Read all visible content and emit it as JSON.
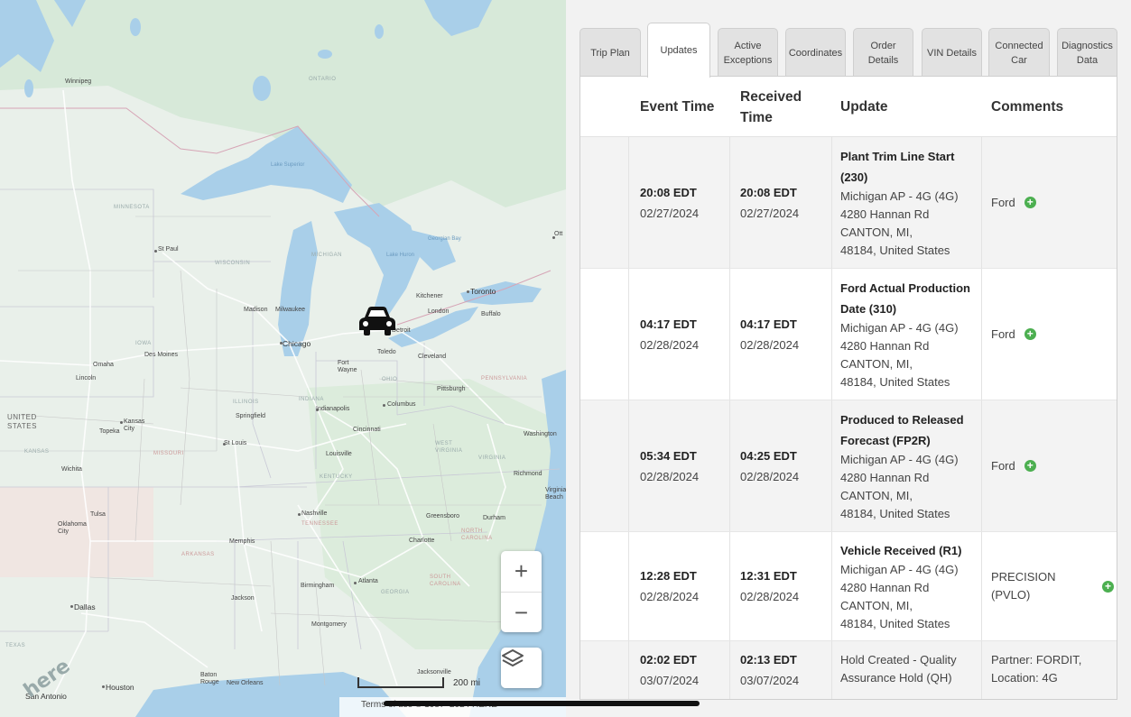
{
  "map": {
    "labels": {
      "winnipeg": "Winnipeg",
      "ontario": "ONTARIO",
      "minnesota": "MINNESOTA",
      "lake_superior": "Lake Superior",
      "st_paul": "St Paul",
      "wisconsin": "WISCONSIN",
      "michigan": "MICHIGAN",
      "lake_huron": "Lake Huron",
      "georgian_bay": "Georgian Bay",
      "ottawa": "Ott",
      "toronto": "Toronto",
      "kitchener": "Kitchener",
      "london": "London",
      "buffalo": "Buffalo",
      "madison": "Madison",
      "milwaukee": "Milwaukee",
      "chicago": "Chicago",
      "detroit": "Detroit",
      "toledo": "Toledo",
      "cleveland": "Cleveland",
      "fort_wayne": "Fort Wayne",
      "iowa": "IOWA",
      "des_moines": "Des Moines",
      "omaha": "Omaha",
      "lincoln": "Lincoln",
      "illinois": "ILLINOIS",
      "indiana": "INDIANA",
      "ohio": "OHIO",
      "pennsylvania": "PENNSYLVANIA",
      "pittsburgh": "Pittsburgh",
      "columbus": "Columbus",
      "indianapolis": "Indianapolis",
      "springfield": "Springfield",
      "cincinnati": "Cincinnati",
      "united_states": "UNITED STATES",
      "kansas_city": "Kansas City",
      "topeka": "Topeka",
      "kansas": "KANSAS",
      "missouri": "MISSOURI",
      "st_louis": "St Louis",
      "louisville": "Louisville",
      "washington": "Washington",
      "west_virginia": "WEST VIRGINIA",
      "virginia": "VIRGINIA",
      "richmond": "Richmond",
      "kentucky": "KENTUCKY",
      "wichita": "Wichita",
      "virginia_beach": "Virginia Beach",
      "tulsa": "Tulsa",
      "oklahoma_city": "Oklahoma City",
      "nashville": "Nashville",
      "tennessee": "TENNESSEE",
      "greensboro": "Greensboro",
      "durham": "Durham",
      "north_carolina": "NORTH CAROLINA",
      "charlotte": "Charlotte",
      "memphis": "Memphis",
      "arkansas": "ARKANSAS",
      "south_carolina": "SOUTH CAROLINA",
      "atlanta": "Atlanta",
      "georgia": "GEORGIA",
      "birmingham": "Birmingham",
      "dallas": "Dallas",
      "jackson": "Jackson",
      "montgomery": "Montgomery",
      "texas": "TEXAS",
      "baton_rouge": "Baton Rouge",
      "new_orleans": "New Orleans",
      "houston": "Houston",
      "jacksonville": "Jacksonville",
      "san_antonio": "San Antonio"
    },
    "vehicle_icon": "car-icon",
    "zoom_in": "+",
    "zoom_out": "−",
    "scale_label": "200 mi",
    "logo": "here",
    "terms_text": "Terms of use   © 1987–2024 HERE"
  },
  "tabs": [
    {
      "label": "Trip Plan"
    },
    {
      "label": "Updates"
    },
    {
      "label": "Active Exceptions"
    },
    {
      "label": "Coordinates"
    },
    {
      "label": "Order Details"
    },
    {
      "label": "VIN Details"
    },
    {
      "label": "Connected Car"
    },
    {
      "label": "Diagnostics Data"
    }
  ],
  "active_tab": "Updates",
  "table": {
    "headers": {
      "event_time": "Event Time",
      "received_time": "Received Time",
      "update": "Update",
      "comments": "Comments"
    },
    "rows": [
      {
        "event_time": "20:08 EDT",
        "event_date": "02/27/2024",
        "received_time": "20:08 EDT",
        "received_date": "02/27/2024",
        "update_title": "Plant Trim Line Start  (230)",
        "update_lines": [
          "Michigan AP - 4G (4G)",
          "4280 Hannan Rd",
          "CANTON, MI,",
          "48184, United States"
        ],
        "comment": "Ford",
        "has_add": true
      },
      {
        "event_time": "04:17 EDT",
        "event_date": "02/28/2024",
        "received_time": "04:17 EDT",
        "received_date": "02/28/2024",
        "update_title": "Ford Actual Production Date  (310)",
        "update_lines": [
          "Michigan AP - 4G (4G)",
          "4280 Hannan Rd",
          "CANTON, MI,",
          "48184, United States"
        ],
        "comment": "Ford",
        "has_add": true
      },
      {
        "event_time": "05:34 EDT",
        "event_date": "02/28/2024",
        "received_time": "04:25 EDT",
        "received_date": "02/28/2024",
        "update_title": "Produced to Released Forecast  (FP2R)",
        "update_lines": [
          "Michigan AP - 4G (4G)",
          "4280 Hannan Rd",
          "CANTON, MI,",
          "48184, United States"
        ],
        "comment": "Ford",
        "has_add": true
      },
      {
        "event_time": "12:28 EDT",
        "event_date": "02/28/2024",
        "received_time": "12:31 EDT",
        "received_date": "02/28/2024",
        "update_title": "Vehicle Received  (R1)",
        "update_lines": [
          "Michigan AP - 4G (4G)",
          "4280 Hannan Rd",
          "CANTON, MI,",
          "48184, United States"
        ],
        "comment": "PRECISION (PVLO)",
        "has_add": true
      },
      {
        "event_time": "02:02 EDT",
        "event_date": "03/07/2024",
        "received_time": "02:13 EDT",
        "received_date": "03/07/2024",
        "update_title": "",
        "update_lines": [
          "Hold Created - Quality",
          "Assurance Hold (QH)"
        ],
        "comment": "Partner: FORDIT,",
        "comment_line2": "Location: 4G",
        "has_add": false
      }
    ]
  },
  "colors": {
    "add_icon": "#4caf50",
    "water": "#a9cfe9",
    "land": "#e7efe8"
  }
}
